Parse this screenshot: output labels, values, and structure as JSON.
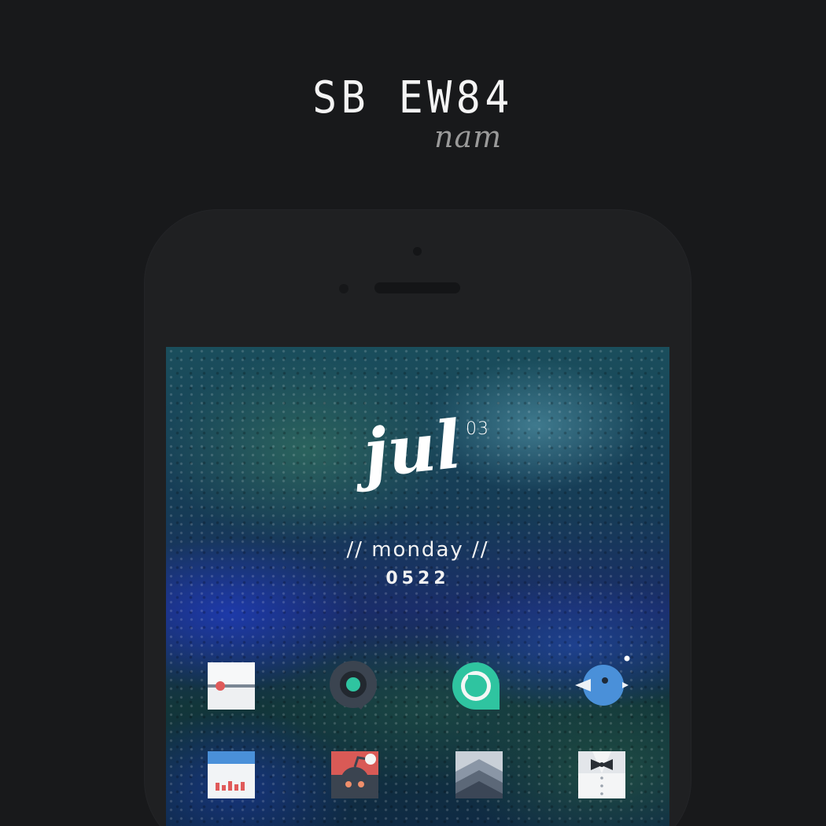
{
  "header": {
    "title": "SB EW84",
    "subtitle": "nam"
  },
  "widget": {
    "day_number": "03",
    "month": "jul",
    "weekday": "// monday //",
    "time": "0522"
  },
  "apps": {
    "row1": [
      {
        "icon": "slider-settings-icon"
      },
      {
        "icon": "chat-bubble-icon"
      },
      {
        "icon": "refresh-bubble-icon"
      },
      {
        "icon": "bird-icon"
      }
    ],
    "row2": [
      {
        "icon": "calendar-chart-icon"
      },
      {
        "icon": "reddit-icon"
      },
      {
        "icon": "chevron-stack-icon"
      },
      {
        "icon": "tuxedo-bowtie-icon"
      }
    ]
  },
  "colors": {
    "background": "#18191b",
    "phone_body": "#1f2022",
    "teal": "#2fc4a0",
    "blue": "#4a90d9",
    "red": "#e05a5a"
  }
}
